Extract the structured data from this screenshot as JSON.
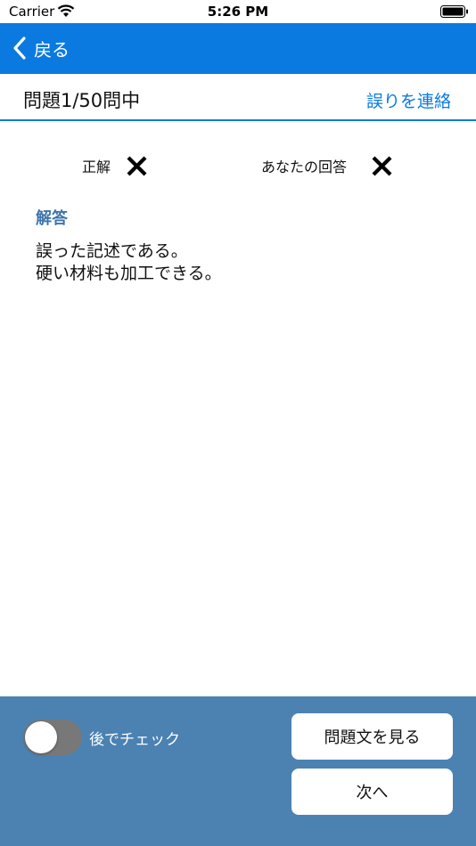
{
  "status_bar": {
    "carrier": "Carrier",
    "time": "5:26 PM",
    "icons": [
      "wifi-icon",
      "battery-icon"
    ]
  },
  "nav": {
    "back_label": "戻る",
    "back_icon": "chevron-left-icon",
    "color": "#0a7ae0"
  },
  "header": {
    "question_counter": "問題1/50問中",
    "report_link": "誤りを連絡"
  },
  "result": {
    "correct_label": "正解",
    "correct_mark": "×",
    "your_answer_label": "あなたの回答",
    "your_answer_mark": "×"
  },
  "answer": {
    "heading": "解答",
    "lines": [
      "誤った記述である。",
      "硬い材料も加工できる。"
    ],
    "heading_color": "#3f74ab"
  },
  "bottom": {
    "toggle_label": "後でチェック",
    "toggle_on": false,
    "view_question_button": "問題文を見る",
    "next_button": "次へ",
    "panel_color": "#4b82b2"
  }
}
